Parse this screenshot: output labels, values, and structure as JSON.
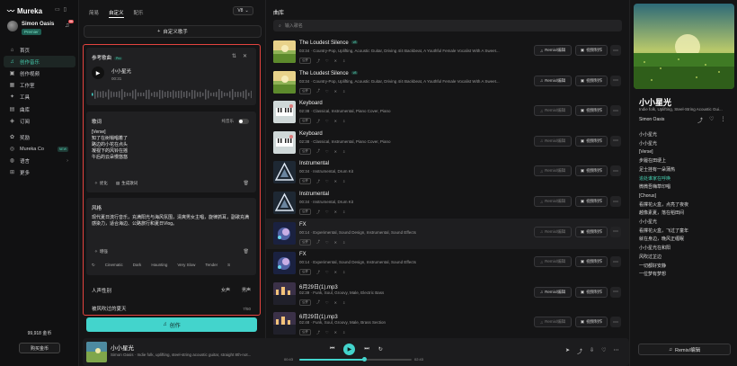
{
  "app": {
    "name": "Mureka"
  },
  "user": {
    "name": "Simon Oasis",
    "plan": "Premier",
    "notifications": "56"
  },
  "nav": [
    {
      "label": "首页",
      "icon": "home-icon",
      "glyph": "⌂"
    },
    {
      "label": "创作音乐",
      "icon": "music-note-icon",
      "glyph": "♫",
      "active": true
    },
    {
      "label": "创作视频",
      "icon": "video-icon",
      "glyph": "▣"
    },
    {
      "label": "工作室",
      "icon": "studio-icon",
      "glyph": "▦"
    },
    {
      "label": "工具",
      "icon": "tools-icon",
      "glyph": "✦"
    },
    {
      "label": "曲库",
      "icon": "library-icon",
      "glyph": "▤"
    },
    {
      "label": "订阅",
      "icon": "subscription-icon",
      "glyph": "◈"
    }
  ],
  "nav2": [
    {
      "label": "奖励",
      "icon": "gift-icon",
      "glyph": "✿"
    },
    {
      "label": "Mureka Co",
      "icon": "co-icon",
      "glyph": "◎",
      "badge": "NEW"
    },
    {
      "label": "语言",
      "icon": "language-icon",
      "glyph": "◍",
      "chev": "›"
    },
    {
      "label": "更多",
      "icon": "more-grid-icon",
      "glyph": "⊞"
    }
  ],
  "credits": "99,918 金币",
  "buy_label": "购买金币",
  "create_panel": {
    "tabs": [
      "简易",
      "自定义",
      "配乐"
    ],
    "active_tab": 1,
    "version": "V8",
    "custom_singer": "自定义歌手",
    "reference": {
      "title": "参考歌曲",
      "pro": "Pro",
      "song": "小小星光",
      "time": "00:31"
    },
    "lyrics": {
      "title": "歌词",
      "instrumental": "纯音乐",
      "text": "[Verse]\n知了在树梢唱着了\n路边的小花在点头\n凝视下的风铃在摇\n午后的云朵慢悠悠",
      "optimize": "优化",
      "generate": "生成歌词"
    },
    "style": {
      "title": "风格",
      "text": "现代夏日流行音乐，充满阳光与海风氛围，清爽男女主唱，旋律抓耳，副歌充满感染力，适合海边、公路旅行和夏日Vlog。",
      "enhance": "增强",
      "tags": [
        "Cinematic",
        "Dark",
        "Haunting",
        "Very Slow",
        "Tender",
        "S"
      ]
    },
    "gender": {
      "label": "人声性别",
      "female": "女声",
      "male": "男声"
    },
    "song_title": {
      "value": "被风吹过的夏天",
      "count": "7/50"
    },
    "create": "创作"
  },
  "library": {
    "title": "曲库",
    "search_placeholder": "输入歌名",
    "public": "公开",
    "remix": "Remix/编辑",
    "video": "视频制作",
    "rows": [
      {
        "title": "The Loudest Silence",
        "v4": true,
        "meta": "03:34 · Country-Pop, Uplifting, Acoustic Guitar, Driving 4/4 Backbeat, A Youthful Female Vocalist With A Sweet...",
        "art": "field"
      },
      {
        "title": "The Loudest Silence",
        "v4": true,
        "meta": "03:34 · Country-Pop, Uplifting, Acoustic Guitar, Driving 4/4 Backbeat, A Youthful Female Vocalist With A Sweet...",
        "art": "field"
      },
      {
        "title": "Keyboard",
        "meta": "02:38 · Classical, Instrumental, Piano Cover, Piano",
        "art": "piano",
        "dim": true
      },
      {
        "title": "Keyboard",
        "meta": "02:38 · Classical, Instrumental, Piano Cover, Piano",
        "art": "piano",
        "dim": true
      },
      {
        "title": "Instrumental",
        "meta": "00:34 · Instrumental, Drum Kit",
        "art": "tri",
        "dim": true
      },
      {
        "title": "Instrumental",
        "meta": "00:34 · Instrumental, Drum Kit",
        "art": "tri",
        "dim": true
      },
      {
        "title": "FX",
        "meta": "00:14 · Experimental, Sound Design, Instrumental, Sound Effects",
        "art": "fx",
        "dim": true
      },
      {
        "title": "FX",
        "meta": "00:14 · Experimental, Sound Design, Instrumental, Sound Effects",
        "art": "fx",
        "dim": true
      },
      {
        "title": "6月29日(1).mp3",
        "meta": "02:39 · Funk, Soul, Groovy, Male, Electric Bass",
        "art": "city"
      },
      {
        "title": "6月29日(1).mp3",
        "meta": "02:48 · Funk, Soul, Groovy, Male, Brass Section",
        "art": "city",
        "dim": true
      }
    ]
  },
  "now_playing": {
    "title": "小小星光",
    "meta": "Simon Oasis · Indie folk, uplifting, steel-string acoustic guitar, straight 8th-not...",
    "current": "00:43",
    "duration": "02:43",
    "progress": 0.58
  },
  "detail": {
    "title": "小小星光",
    "meta": "Indie folk, Uplifting, Steel-String Acoustic Gui...",
    "author": "Simon Oasis",
    "lyrics": [
      "小小星光",
      "小小星光",
      "[Verse]",
      "步履在田埂上",
      "足士挂有一朵蒲热",
      "追处谁家在呼唤",
      "微微吾嗨草印唱",
      "[Chorus]",
      "看撑花火盒，点亮了夜夜",
      "越像素夏，落在稻田间",
      "小小星光",
      "看撑花火盒，飞过了童年",
      "就在身边，晚风正缠眠",
      "小小星光在和阳",
      "风吹过芷边",
      "一切都好安静",
      "一位梦有梦想"
    ],
    "remix": "Remix/编辑"
  },
  "colors": {
    "accent": "#43d4cc",
    "active_nav": "#46d1b2",
    "highlight_border": "#e4433f"
  }
}
